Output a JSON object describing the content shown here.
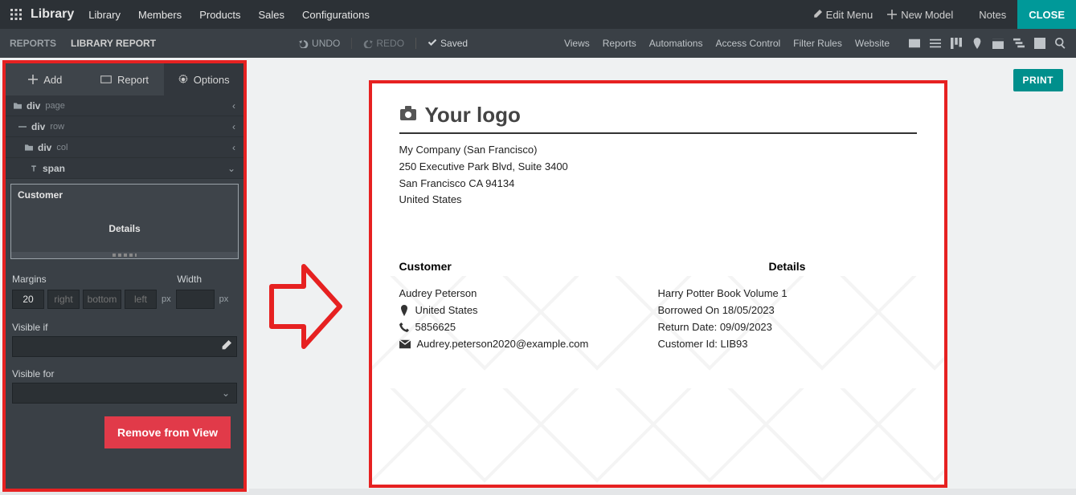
{
  "topbar": {
    "brand": "Library",
    "menu": [
      "Library",
      "Members",
      "Products",
      "Sales",
      "Configurations"
    ],
    "edit_menu": "Edit Menu",
    "new_model": "New Model",
    "notes": "Notes",
    "close": "CLOSE"
  },
  "subbar": {
    "left": [
      "REPORTS",
      "LIBRARY REPORT"
    ],
    "undo": "UNDO",
    "redo": "REDO",
    "saved": "Saved",
    "right_links": [
      "Views",
      "Reports",
      "Automations",
      "Access Control",
      "Filter Rules",
      "Website"
    ]
  },
  "side_tabs": {
    "add": "Add",
    "report": "Report",
    "options": "Options"
  },
  "tree": [
    {
      "indent": 0,
      "icon": "folder",
      "tag": "div",
      "cls": "page",
      "chev": "left"
    },
    {
      "indent": 1,
      "icon": "dash",
      "tag": "div",
      "cls": "row",
      "chev": "left"
    },
    {
      "indent": 2,
      "icon": "folder",
      "tag": "div",
      "cls": "col",
      "chev": "left"
    },
    {
      "indent": 3,
      "icon": "text",
      "tag": "span",
      "cls": "",
      "chev": "down"
    }
  ],
  "panel": {
    "title": "Customer",
    "center": "Details"
  },
  "form": {
    "margins_label": "Margins",
    "width_label": "Width",
    "margin_top": "20",
    "margin_right_ph": "right",
    "margin_bottom_ph": "bottom",
    "margin_left_ph": "left",
    "unit": "px",
    "visible_if": "Visible if",
    "visible_for": "Visible for",
    "remove": "Remove from View"
  },
  "print": "PRINT",
  "report": {
    "logo_text": "Your logo",
    "company": "My Company (San Francisco)",
    "addr1": "250 Executive Park Blvd, Suite 3400",
    "addr2": "San Francisco CA 94134",
    "country": "United States",
    "customer_h": "Customer",
    "details_h": "Details",
    "customer": {
      "name": "Audrey Peterson",
      "loc": "United States",
      "phone": "5856625",
      "email": "Audrey.peterson2020@example.com"
    },
    "details": {
      "book": "Harry Potter Book Volume 1",
      "borrowed": "Borrowed On 18/05/2023",
      "return": "Return Date: 09/09/2023",
      "cust_id": "Customer Id: LIB93"
    }
  }
}
